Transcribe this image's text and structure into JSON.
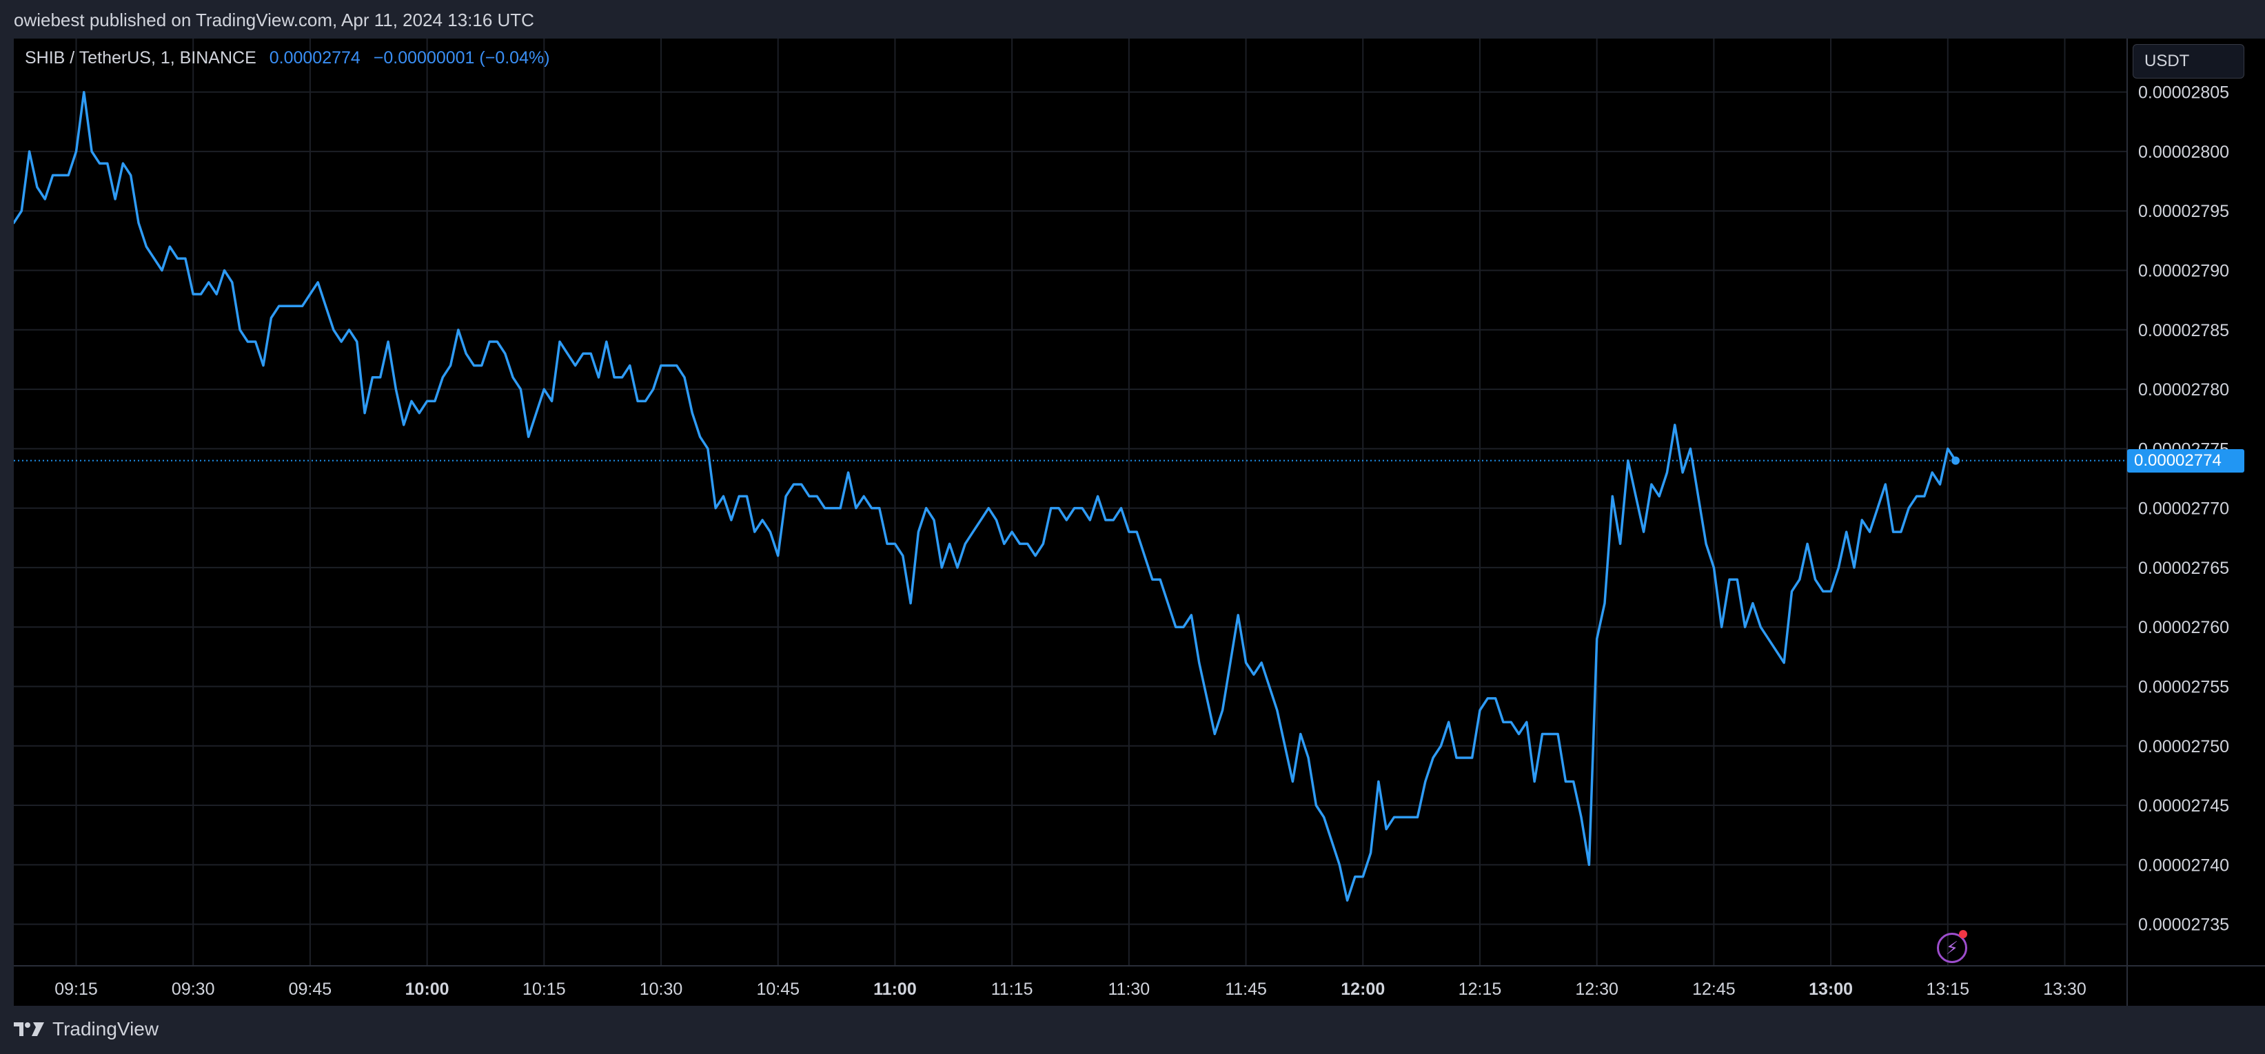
{
  "header": {
    "attribution": "owiebest published on TradingView.com, Apr 11, 2024 13:16 UTC"
  },
  "legend": {
    "symbol": "SHIB / TetherUS, 1, BINANCE",
    "last": "0.00002774",
    "change": "−0.00000001 (−0.04%)"
  },
  "price_scale": {
    "currency_label": "USDT",
    "current_price_label": "0.00002774"
  },
  "footer": {
    "logo_text": "TradingView"
  },
  "colors": {
    "background": "#000000",
    "chrome": "#1e222d",
    "line": "#2e9bf5",
    "text": "#d1d4dc",
    "price_tag": "#2196f3"
  },
  "icons": {
    "bolt": "lightning-bolt-icon",
    "logo": "tradingview-logo-icon"
  },
  "chart_data": {
    "type": "line",
    "title": "SHIB / TetherUS, 1, BINANCE",
    "xlabel": "",
    "ylabel": "",
    "x_ticks": [
      {
        "t": 0,
        "label": "09:15",
        "bold": false
      },
      {
        "t": 15,
        "label": "09:30",
        "bold": false
      },
      {
        "t": 30,
        "label": "09:45",
        "bold": false
      },
      {
        "t": 45,
        "label": "10:00",
        "bold": true
      },
      {
        "t": 60,
        "label": "10:15",
        "bold": false
      },
      {
        "t": 75,
        "label": "10:30",
        "bold": false
      },
      {
        "t": 90,
        "label": "10:45",
        "bold": false
      },
      {
        "t": 105,
        "label": "11:00",
        "bold": true
      },
      {
        "t": 120,
        "label": "11:15",
        "bold": false
      },
      {
        "t": 135,
        "label": "11:30",
        "bold": false
      },
      {
        "t": 150,
        "label": "11:45",
        "bold": false
      },
      {
        "t": 165,
        "label": "12:00",
        "bold": true
      },
      {
        "t": 180,
        "label": "12:15",
        "bold": false
      },
      {
        "t": 195,
        "label": "12:30",
        "bold": false
      },
      {
        "t": 210,
        "label": "12:45",
        "bold": false
      },
      {
        "t": 225,
        "label": "13:00",
        "bold": true
      },
      {
        "t": 240,
        "label": "13:15",
        "bold": false
      },
      {
        "t": 255,
        "label": "13:30",
        "bold": false
      }
    ],
    "y_ticks": [
      2.735e-05,
      2.74e-05,
      2.745e-05,
      2.75e-05,
      2.755e-05,
      2.76e-05,
      2.765e-05,
      2.77e-05,
      2.775e-05,
      2.78e-05,
      2.785e-05,
      2.79e-05,
      2.795e-05,
      2.8e-05,
      2.805e-05
    ],
    "y_tick_labels": [
      "0.00002735",
      "0.00002740",
      "0.00002745",
      "0.00002750",
      "0.00002755",
      "0.00002760",
      "0.00002765",
      "0.00002770",
      "0.00002775",
      "0.00002780",
      "0.00002785",
      "0.00002790",
      "0.00002795",
      "0.00002800",
      "0.00002805"
    ],
    "ylim": [
      2.7315e-05,
      2.8095e-05
    ],
    "xlim": [
      -8,
      263
    ],
    "current_price": 2.774e-05,
    "grid": true,
    "series": [
      {
        "values": [
          [
            -8,
            2.794e-05
          ],
          [
            -7,
            2.795e-05
          ],
          [
            -6,
            2.8e-05
          ],
          [
            -5,
            2.797e-05
          ],
          [
            -4,
            2.796e-05
          ],
          [
            -3,
            2.798e-05
          ],
          [
            -2,
            2.798e-05
          ],
          [
            -1,
            2.798e-05
          ],
          [
            0,
            2.8e-05
          ],
          [
            1,
            2.805e-05
          ],
          [
            2,
            2.8e-05
          ],
          [
            3,
            2.799e-05
          ],
          [
            4,
            2.799e-05
          ],
          [
            5,
            2.796e-05
          ],
          [
            6,
            2.799e-05
          ],
          [
            7,
            2.798e-05
          ],
          [
            8,
            2.794e-05
          ],
          [
            9,
            2.792e-05
          ],
          [
            10,
            2.791e-05
          ],
          [
            11,
            2.79e-05
          ],
          [
            12,
            2.792e-05
          ],
          [
            13,
            2.791e-05
          ],
          [
            14,
            2.791e-05
          ],
          [
            15,
            2.788e-05
          ],
          [
            16,
            2.788e-05
          ],
          [
            17,
            2.789e-05
          ],
          [
            18,
            2.788e-05
          ],
          [
            19,
            2.79e-05
          ],
          [
            20,
            2.789e-05
          ],
          [
            21,
            2.785e-05
          ],
          [
            22,
            2.784e-05
          ],
          [
            23,
            2.784e-05
          ],
          [
            24,
            2.782e-05
          ],
          [
            25,
            2.786e-05
          ],
          [
            26,
            2.787e-05
          ],
          [
            27,
            2.787e-05
          ],
          [
            28,
            2.787e-05
          ],
          [
            29,
            2.787e-05
          ],
          [
            30,
            2.788e-05
          ],
          [
            31,
            2.789e-05
          ],
          [
            32,
            2.787e-05
          ],
          [
            33,
            2.785e-05
          ],
          [
            34,
            2.784e-05
          ],
          [
            35,
            2.785e-05
          ],
          [
            36,
            2.784e-05
          ],
          [
            37,
            2.778e-05
          ],
          [
            38,
            2.781e-05
          ],
          [
            39,
            2.781e-05
          ],
          [
            40,
            2.784e-05
          ],
          [
            41,
            2.78e-05
          ],
          [
            42,
            2.777e-05
          ],
          [
            43,
            2.779e-05
          ],
          [
            44,
            2.778e-05
          ],
          [
            45,
            2.779e-05
          ],
          [
            46,
            2.779e-05
          ],
          [
            47,
            2.781e-05
          ],
          [
            48,
            2.782e-05
          ],
          [
            49,
            2.785e-05
          ],
          [
            50,
            2.783e-05
          ],
          [
            51,
            2.782e-05
          ],
          [
            52,
            2.782e-05
          ],
          [
            53,
            2.784e-05
          ],
          [
            54,
            2.784e-05
          ],
          [
            55,
            2.783e-05
          ],
          [
            56,
            2.781e-05
          ],
          [
            57,
            2.78e-05
          ],
          [
            58,
            2.776e-05
          ],
          [
            59,
            2.778e-05
          ],
          [
            60,
            2.78e-05
          ],
          [
            61,
            2.779e-05
          ],
          [
            62,
            2.784e-05
          ],
          [
            63,
            2.783e-05
          ],
          [
            64,
            2.782e-05
          ],
          [
            65,
            2.783e-05
          ],
          [
            66,
            2.783e-05
          ],
          [
            67,
            2.781e-05
          ],
          [
            68,
            2.784e-05
          ],
          [
            69,
            2.781e-05
          ],
          [
            70,
            2.781e-05
          ],
          [
            71,
            2.782e-05
          ],
          [
            72,
            2.779e-05
          ],
          [
            73,
            2.779e-05
          ],
          [
            74,
            2.78e-05
          ],
          [
            75,
            2.782e-05
          ],
          [
            76,
            2.782e-05
          ],
          [
            77,
            2.782e-05
          ],
          [
            78,
            2.781e-05
          ],
          [
            79,
            2.778e-05
          ],
          [
            80,
            2.776e-05
          ],
          [
            81,
            2.775e-05
          ],
          [
            82,
            2.77e-05
          ],
          [
            83,
            2.771e-05
          ],
          [
            84,
            2.769e-05
          ],
          [
            85,
            2.771e-05
          ],
          [
            86,
            2.771e-05
          ],
          [
            87,
            2.768e-05
          ],
          [
            88,
            2.769e-05
          ],
          [
            89,
            2.768e-05
          ],
          [
            90,
            2.766e-05
          ],
          [
            91,
            2.771e-05
          ],
          [
            92,
            2.772e-05
          ],
          [
            93,
            2.772e-05
          ],
          [
            94,
            2.771e-05
          ],
          [
            95,
            2.771e-05
          ],
          [
            96,
            2.77e-05
          ],
          [
            97,
            2.77e-05
          ],
          [
            98,
            2.77e-05
          ],
          [
            99,
            2.773e-05
          ],
          [
            100,
            2.77e-05
          ],
          [
            101,
            2.771e-05
          ],
          [
            102,
            2.77e-05
          ],
          [
            103,
            2.77e-05
          ],
          [
            104,
            2.767e-05
          ],
          [
            105,
            2.767e-05
          ],
          [
            106,
            2.766e-05
          ],
          [
            107,
            2.762e-05
          ],
          [
            108,
            2.768e-05
          ],
          [
            109,
            2.77e-05
          ],
          [
            110,
            2.769e-05
          ],
          [
            111,
            2.765e-05
          ],
          [
            112,
            2.767e-05
          ],
          [
            113,
            2.765e-05
          ],
          [
            114,
            2.767e-05
          ],
          [
            115,
            2.768e-05
          ],
          [
            116,
            2.769e-05
          ],
          [
            117,
            2.77e-05
          ],
          [
            118,
            2.769e-05
          ],
          [
            119,
            2.767e-05
          ],
          [
            120,
            2.768e-05
          ],
          [
            121,
            2.767e-05
          ],
          [
            122,
            2.767e-05
          ],
          [
            123,
            2.766e-05
          ],
          [
            124,
            2.767e-05
          ],
          [
            125,
            2.77e-05
          ],
          [
            126,
            2.77e-05
          ],
          [
            127,
            2.769e-05
          ],
          [
            128,
            2.77e-05
          ],
          [
            129,
            2.77e-05
          ],
          [
            130,
            2.769e-05
          ],
          [
            131,
            2.771e-05
          ],
          [
            132,
            2.769e-05
          ],
          [
            133,
            2.769e-05
          ],
          [
            134,
            2.77e-05
          ],
          [
            135,
            2.768e-05
          ],
          [
            136,
            2.768e-05
          ],
          [
            137,
            2.766e-05
          ],
          [
            138,
            2.764e-05
          ],
          [
            139,
            2.764e-05
          ],
          [
            140,
            2.762e-05
          ],
          [
            141,
            2.76e-05
          ],
          [
            142,
            2.76e-05
          ],
          [
            143,
            2.761e-05
          ],
          [
            144,
            2.757e-05
          ],
          [
            145,
            2.754e-05
          ],
          [
            146,
            2.751e-05
          ],
          [
            147,
            2.753e-05
          ],
          [
            148,
            2.757e-05
          ],
          [
            149,
            2.761e-05
          ],
          [
            150,
            2.757e-05
          ],
          [
            151,
            2.756e-05
          ],
          [
            152,
            2.757e-05
          ],
          [
            153,
            2.755e-05
          ],
          [
            154,
            2.753e-05
          ],
          [
            155,
            2.75e-05
          ],
          [
            156,
            2.747e-05
          ],
          [
            157,
            2.751e-05
          ],
          [
            158,
            2.749e-05
          ],
          [
            159,
            2.745e-05
          ],
          [
            160,
            2.744e-05
          ],
          [
            161,
            2.742e-05
          ],
          [
            162,
            2.74e-05
          ],
          [
            163,
            2.737e-05
          ],
          [
            164,
            2.739e-05
          ],
          [
            165,
            2.739e-05
          ],
          [
            166,
            2.741e-05
          ],
          [
            167,
            2.747e-05
          ],
          [
            168,
            2.743e-05
          ],
          [
            169,
            2.744e-05
          ],
          [
            170,
            2.744e-05
          ],
          [
            171,
            2.744e-05
          ],
          [
            172,
            2.744e-05
          ],
          [
            173,
            2.747e-05
          ],
          [
            174,
            2.749e-05
          ],
          [
            175,
            2.75e-05
          ],
          [
            176,
            2.752e-05
          ],
          [
            177,
            2.749e-05
          ],
          [
            178,
            2.749e-05
          ],
          [
            179,
            2.749e-05
          ],
          [
            180,
            2.753e-05
          ],
          [
            181,
            2.754e-05
          ],
          [
            182,
            2.754e-05
          ],
          [
            183,
            2.752e-05
          ],
          [
            184,
            2.752e-05
          ],
          [
            185,
            2.751e-05
          ],
          [
            186,
            2.752e-05
          ],
          [
            187,
            2.747e-05
          ],
          [
            188,
            2.751e-05
          ],
          [
            189,
            2.751e-05
          ],
          [
            190,
            2.751e-05
          ],
          [
            191,
            2.747e-05
          ],
          [
            192,
            2.747e-05
          ],
          [
            193,
            2.744e-05
          ],
          [
            194,
            2.74e-05
          ],
          [
            195,
            2.759e-05
          ],
          [
            196,
            2.762e-05
          ],
          [
            197,
            2.771e-05
          ],
          [
            198,
            2.767e-05
          ],
          [
            199,
            2.774e-05
          ],
          [
            200,
            2.771e-05
          ],
          [
            201,
            2.768e-05
          ],
          [
            202,
            2.772e-05
          ],
          [
            203,
            2.771e-05
          ],
          [
            204,
            2.773e-05
          ],
          [
            205,
            2.777e-05
          ],
          [
            206,
            2.773e-05
          ],
          [
            207,
            2.775e-05
          ],
          [
            208,
            2.771e-05
          ],
          [
            209,
            2.767e-05
          ],
          [
            210,
            2.765e-05
          ],
          [
            211,
            2.76e-05
          ],
          [
            212,
            2.764e-05
          ],
          [
            213,
            2.764e-05
          ],
          [
            214,
            2.76e-05
          ],
          [
            215,
            2.762e-05
          ],
          [
            216,
            2.76e-05
          ],
          [
            217,
            2.759e-05
          ],
          [
            218,
            2.758e-05
          ],
          [
            219,
            2.757e-05
          ],
          [
            220,
            2.763e-05
          ],
          [
            221,
            2.764e-05
          ],
          [
            222,
            2.767e-05
          ],
          [
            223,
            2.764e-05
          ],
          [
            224,
            2.763e-05
          ],
          [
            225,
            2.763e-05
          ],
          [
            226,
            2.765e-05
          ],
          [
            227,
            2.768e-05
          ],
          [
            228,
            2.765e-05
          ],
          [
            229,
            2.769e-05
          ],
          [
            230,
            2.768e-05
          ],
          [
            231,
            2.77e-05
          ],
          [
            232,
            2.772e-05
          ],
          [
            233,
            2.768e-05
          ],
          [
            234,
            2.768e-05
          ],
          [
            235,
            2.77e-05
          ],
          [
            236,
            2.771e-05
          ],
          [
            237,
            2.771e-05
          ],
          [
            238,
            2.773e-05
          ],
          [
            239,
            2.772e-05
          ],
          [
            240,
            2.775e-05
          ],
          [
            241,
            2.774e-05
          ]
        ]
      }
    ]
  }
}
